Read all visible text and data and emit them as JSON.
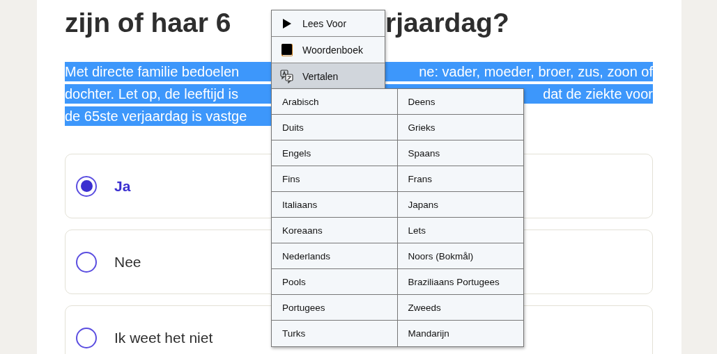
{
  "question": {
    "heading_left": "zijn of haar 6",
    "heading_right": "rjaardag?"
  },
  "description": {
    "lines": [
      {
        "left": "Met directe familie bedoelen",
        "right": "ne: vader, moeder, broer, zus, zoon of"
      },
      {
        "left": "dochter. Let op, de leeftijd is",
        "right": "dat de ziekte voor"
      },
      {
        "left": "de 65ste verjaardag is vastge"
      }
    ]
  },
  "options": [
    {
      "label": "Ja",
      "selected": true
    },
    {
      "label": "Nee",
      "selected": false
    },
    {
      "label": "Ik weet het niet",
      "selected": false
    }
  ],
  "context_menu": {
    "items": [
      {
        "label": "Lees Voor",
        "kind": "play",
        "selected": false
      },
      {
        "label": "Woordenboek",
        "kind": "book",
        "selected": false
      },
      {
        "label": "Vertalen",
        "kind": "translate",
        "selected": true
      }
    ]
  },
  "submenu": {
    "languages": [
      "Arabisch",
      "Deens",
      "Duits",
      "Grieks",
      "Engels",
      "Spaans",
      "Fins",
      "Frans",
      "Italiaans",
      "Japans",
      "Koreaans",
      "Lets",
      "Nederlands",
      "Noors (Bokmål)",
      "Pools",
      "Braziliaans Portugees",
      "Portugees",
      "Zweeds",
      "Turks",
      "Mandarijn"
    ]
  }
}
